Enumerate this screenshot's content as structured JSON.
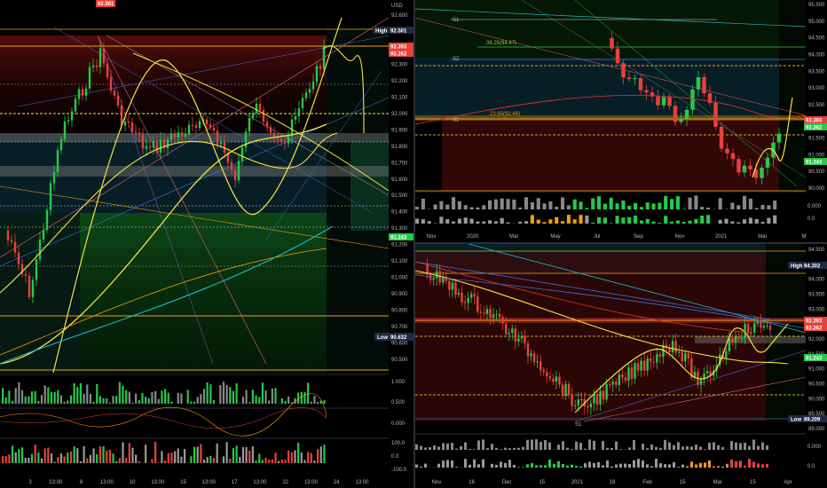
{
  "colors": {
    "bull": "#26c94a",
    "bear": "#e8413b",
    "yellow": "#f5e342",
    "orange": "#f39c12",
    "cyan": "#1fb6c4",
    "blue": "#3f6fd8",
    "purple": "#9b59b6",
    "grid": "#1a1a1a",
    "red_zone": "#4a0c0c",
    "green_zone": "#0b3d14",
    "teal_zone": "#0a2a33"
  },
  "left_chart": {
    "currency": "USD",
    "price_axis": [
      "92.600",
      "92.500",
      "92.400",
      "92.300",
      "92.200",
      "92.100",
      "92.000",
      "91.900",
      "91.800",
      "91.700",
      "91.600",
      "91.500",
      "91.400",
      "91.300",
      "91.200",
      "91.100",
      "91.000",
      "90.900",
      "90.800",
      "90.700",
      "90.600",
      "90.500"
    ],
    "high_label": "High",
    "high_value": "92.501",
    "price_tag_1": "92.393",
    "price_tag_2": "92.262",
    "tag_level": "91.243",
    "low_label": "Low",
    "low_value": "90.632",
    "top_marker": "92.501",
    "osc1_axis": [
      "1.000",
      "0.500",
      "0.000"
    ],
    "osc2_axis": [
      "100.0",
      "0.0",
      "-100.0"
    ],
    "x_labels": [
      "3",
      "13:00",
      "8",
      "13:00",
      "10",
      "13:00",
      "15",
      "13:00",
      "17",
      "13:00",
      "22",
      "13:00",
      "24",
      "13:00"
    ]
  },
  "top_right_chart": {
    "price_axis": [
      "95.500",
      "95.000",
      "94.500",
      "94.000",
      "93.500",
      "93.000",
      "92.500",
      "92.000",
      "91.500",
      "91.000",
      "90.500",
      "90.000"
    ],
    "fib_1": "38.25(94.47)",
    "fib_2": "23.65(92.46)",
    "s1": "S1",
    "s2": "S2",
    "price_tag_1": "92.393",
    "price_tag_2": "92.262",
    "tag_level": "91.243",
    "osc_axis": [
      "0.000",
      "0.0"
    ],
    "x_labels": [
      "Nov",
      "2020",
      "Mar",
      "May",
      "Jul",
      "Sep",
      "Nov",
      "2021",
      "Mar",
      "M"
    ]
  },
  "bottom_right_chart": {
    "price_axis": [
      "94.500",
      "94.300",
      "94.000",
      "93.500",
      "93.000",
      "92.500",
      "92.000",
      "91.500",
      "91.000",
      "90.500",
      "90.000",
      "89.500",
      "89.000"
    ],
    "high_label": "High",
    "high_value": "94.302",
    "low_label": "Low",
    "low_value": "89.209",
    "price_tag_1": "92.393",
    "price_tag_2": "92.262",
    "tag_level": "91.243",
    "s1": "S1",
    "osc_axis": [
      "0.000",
      "0.0"
    ],
    "x_labels": [
      "Nov",
      "16",
      "Dec",
      "15",
      "2021",
      "18",
      "Feb",
      "15",
      "Mar",
      "15",
      "Apr"
    ]
  }
}
